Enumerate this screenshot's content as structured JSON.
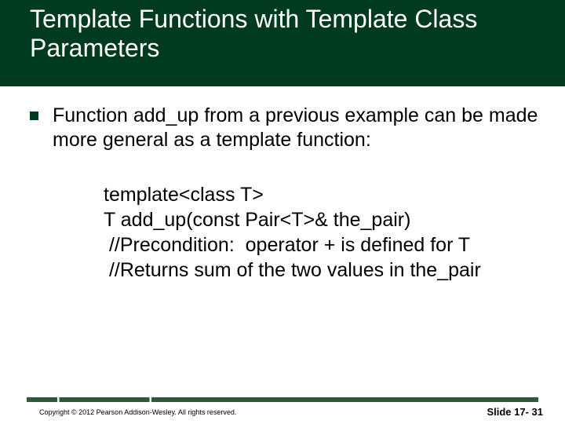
{
  "title": "Template Functions with Template Class Parameters",
  "bullet": "Function add_up from a previous example can be made more general as a template function:",
  "code": {
    "l1": "template<class T>",
    "l2": "T add_up(const Pair<T>& the_pair)",
    "l3": " //Precondition:  operator + is defined for T",
    "l4": " //Returns sum of the two values in the_pair"
  },
  "footer": {
    "copyright": "Copyright © 2012 Pearson Addison-Wesley.  All rights reserved.",
    "slide": "Slide 17- 31"
  }
}
